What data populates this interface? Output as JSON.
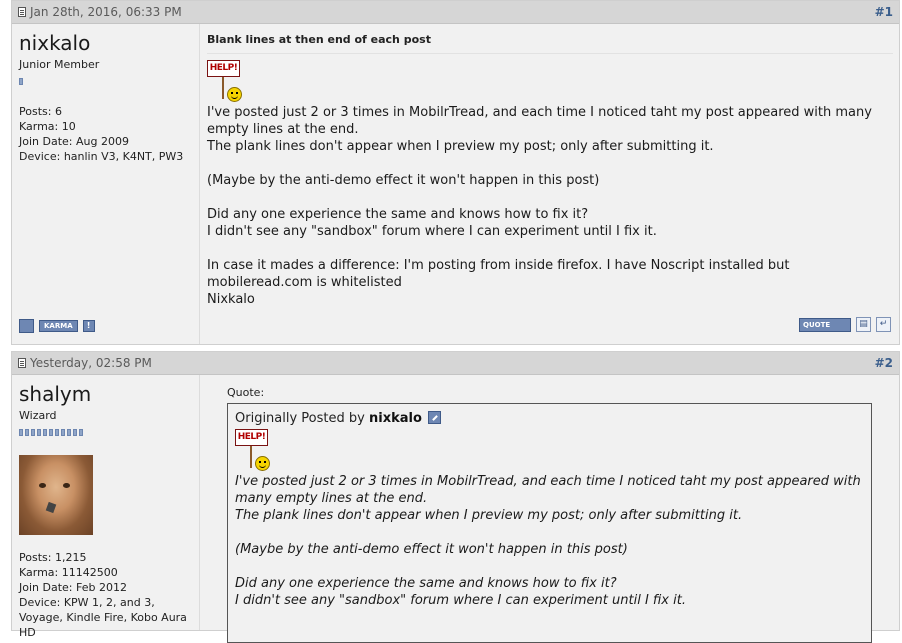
{
  "posts": [
    {
      "date": "Jan 28th, 2016, 06:33 PM",
      "number": "#1",
      "author": {
        "name": "nixkalo",
        "title": "Junior Member",
        "reputation_pips": 1,
        "posts_label": "Posts: 6",
        "karma_label": "Karma: 10",
        "join_label": "Join Date: Aug 2009",
        "device_label": "Device: hanlin V3, K4NT, PW3"
      },
      "title": "Blank lines at then end of each post",
      "smiley": {
        "icon": "help-sign-smiley-icon",
        "text": "HELP!"
      },
      "lines": [
        "I've posted just 2 or 3 times in MobilrTread, and each time I noticed taht my post appeared with many empty lines at the end.",
        "The plank lines don't appear when I preview my post; only after submitting it.",
        "",
        "(Maybe by the anti-demo effect it won't happen in this post)",
        "",
        "Did any one experience the same and knows how to fix it?",
        "I didn't see any \"sandbox\" forum where I can experiment until I fix it.",
        "",
        "In case it mades a difference: I'm posting from inside firefox. I have Noscript installed but mobileread.com is whitelisted",
        "Nixkalo"
      ],
      "buttons": {
        "karma_label": "KARMA",
        "report_label": "!",
        "quote_label": "QUOTE"
      }
    },
    {
      "date": "Yesterday, 02:58 PM",
      "number": "#2",
      "author": {
        "name": "shalym",
        "title": "Wizard",
        "reputation_pips": 11,
        "posts_label": "Posts: 1,215",
        "karma_label": "Karma: 11142500",
        "join_label": "Join Date: Feb 2012",
        "device_label": "Device: KPW 1, 2, and 3, Voyage, Kindle Fire, Kobo Aura HD"
      },
      "quote": {
        "label": "Quote:",
        "prefix": "Originally Posted by",
        "author": "nixkalo",
        "smiley": {
          "icon": "help-sign-smiley-icon",
          "text": "HELP!"
        },
        "lines": [
          "I've posted just 2 or 3 times in MobilrTread, and each time I noticed taht my post appeared with many empty lines at the end.",
          "The plank lines don't appear when I preview my post; only after submitting it.",
          "",
          "(Maybe by the anti-demo effect it won't happen in this post)",
          "",
          "Did any one experience the same and knows how to fix it?",
          "I didn't see any \"sandbox\" forum where I can experiment until I fix it."
        ]
      }
    }
  ]
}
